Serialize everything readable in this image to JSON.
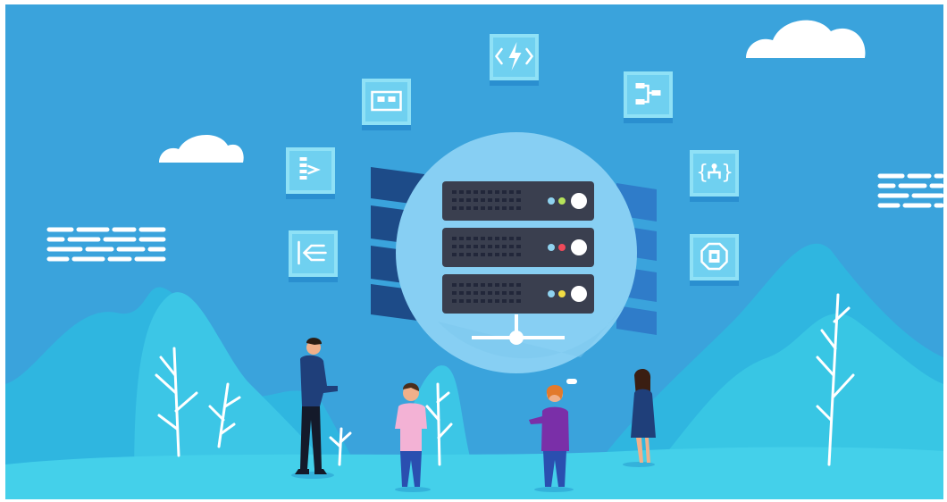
{
  "scene": {
    "description_label": "",
    "colors": {
      "background": "#3aa3dc",
      "frame": "#ffffff",
      "hill_light": "#38c6e4",
      "hill_mid": "#2bb5e0",
      "ground": "#3ccbe6",
      "circle": "#87cff3",
      "server_body": "#3a3f4f",
      "server_stripe": "#22273a",
      "slab_dark": "#1d4b88",
      "slab_light": "#2f7cc9",
      "tile_top": "#8fe1f6",
      "tile_front": "#5cc4ea",
      "cloud": "#ffffff"
    },
    "icons": [
      "lightning-code-icon",
      "mail-inbox-icon",
      "flowchart-icon",
      "stack-list-icon",
      "json-hierarchy-icon",
      "merge-arrows-icon",
      "badge-disk-icon"
    ],
    "server_lights": [
      [
        "#8fd3f0",
        "#b6e35a"
      ],
      [
        "#8fd3f0",
        "#f04a5a"
      ],
      [
        "#8fd3f0",
        "#f2dd44"
      ]
    ],
    "people": [
      "presenter",
      "child-pink-shirt",
      "woman-purple-shirt",
      "girl-blue-dress"
    ]
  }
}
